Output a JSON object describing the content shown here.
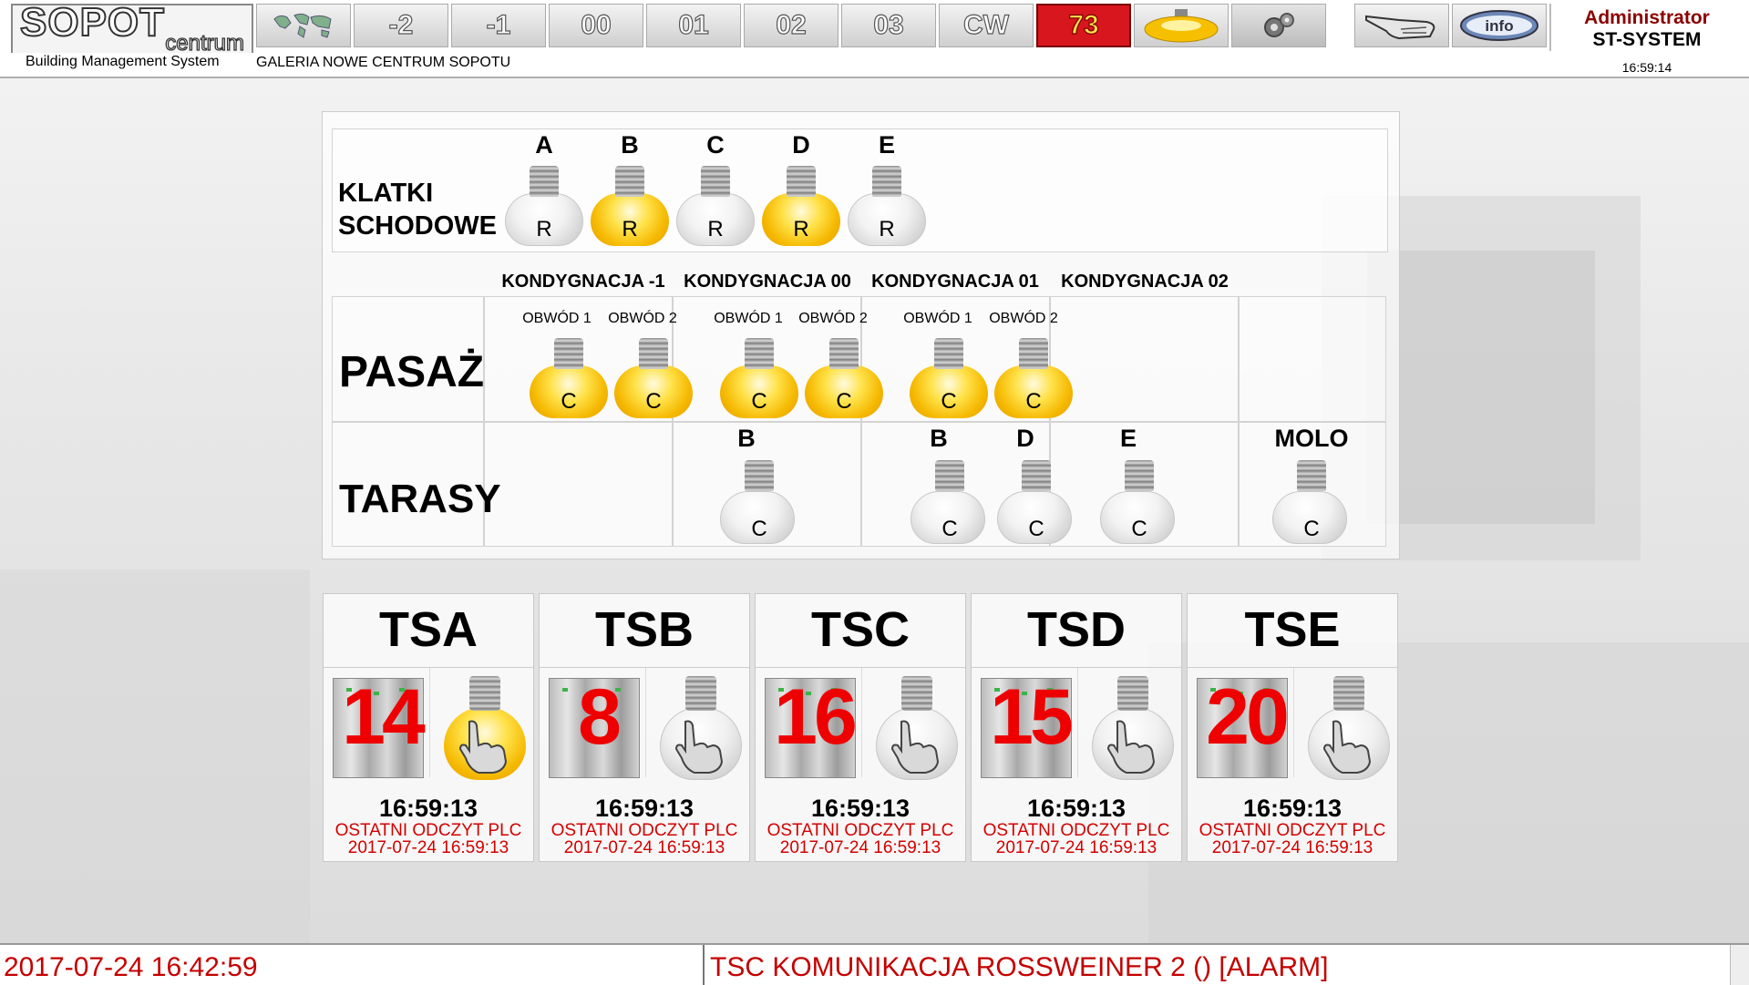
{
  "header": {
    "logo_main": "SOPOT",
    "logo_sub": "centrum",
    "subtitle": "Building Management System",
    "gallery": "GALERIA NOWE CENTRUM SOPOTU",
    "nav": [
      "-2",
      "-1",
      "00",
      "01",
      "02",
      "03",
      "CW"
    ],
    "alarm_count": "73",
    "user": "Administrator",
    "system": "ST-SYSTEM",
    "time": "16:59:14"
  },
  "klatki": {
    "label_line1": "KLATKI",
    "label_line2": "SCHODOWE",
    "bulbs": [
      {
        "name": "A",
        "letter": "R",
        "state": "off"
      },
      {
        "name": "B",
        "letter": "R",
        "state": "on"
      },
      {
        "name": "C",
        "letter": "R",
        "state": "off"
      },
      {
        "name": "D",
        "letter": "R",
        "state": "on"
      },
      {
        "name": "E",
        "letter": "R",
        "state": "off"
      }
    ]
  },
  "levels": [
    "KONDYGNACJA -1",
    "KONDYGNACJA 00",
    "KONDYGNACJA 01",
    "KONDYGNACJA 02"
  ],
  "pasaz": {
    "label": "PASAŻ",
    "circuit1": "OBWÓD 1",
    "circuit2": "OBWÓD 2",
    "letter": "C"
  },
  "tarasy": {
    "label": "TARASY",
    "b1": "B",
    "b2": "B",
    "d": "D",
    "e": "E",
    "molo": "MOLO",
    "letter": "C"
  },
  "controllers": [
    {
      "name": "TSA",
      "count": "14",
      "light": "on",
      "time": "16:59:13",
      "last": "OSTATNI ODCZYT PLC",
      "date": "2017-07-24 16:59:13"
    },
    {
      "name": "TSB",
      "count": "8",
      "light": "off",
      "time": "16:59:13",
      "last": "OSTATNI ODCZYT PLC",
      "date": "2017-07-24 16:59:13"
    },
    {
      "name": "TSC",
      "count": "16",
      "light": "off",
      "time": "16:59:13",
      "last": "OSTATNI ODCZYT PLC",
      "date": "2017-07-24 16:59:13"
    },
    {
      "name": "TSD",
      "count": "15",
      "light": "off",
      "time": "16:59:13",
      "last": "OSTATNI ODCZYT PLC",
      "date": "2017-07-24 16:59:13"
    },
    {
      "name": "TSE",
      "count": "20",
      "light": "off",
      "time": "16:59:13",
      "last": "OSTATNI ODCZYT PLC",
      "date": "2017-07-24 16:59:13"
    }
  ],
  "footer": {
    "date": "2017-07-24 16:42:59",
    "message": "TSC  KOMUNIKACJA ROSSWEINER 2  () [ALARM]"
  },
  "colors": {
    "alarm_red": "#d8161e",
    "text_red": "#d40000",
    "bulb_on": "#f5b800"
  }
}
